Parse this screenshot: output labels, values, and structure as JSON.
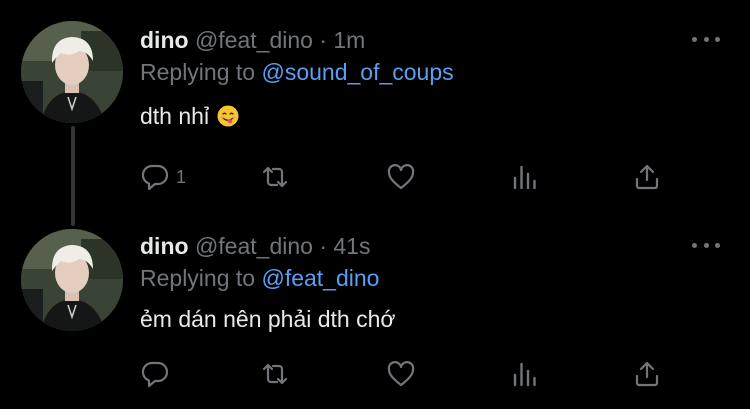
{
  "colors": {
    "background": "#000000",
    "text_primary": "#e7e9ea",
    "text_secondary": "#71767b",
    "link": "#5b9ef5",
    "thread_line": "#333639"
  },
  "tweets": [
    {
      "display_name": "dino",
      "handle": "@feat_dino",
      "separator": "·",
      "time": "1m",
      "replying_prefix": "Replying to",
      "replying_to": "@sound_of_coups",
      "text": "dth nhỉ",
      "emoji": "smiling-face-tongue-icon",
      "actions": {
        "reply_icon": "reply-icon",
        "reply_count": "1",
        "retweet_icon": "retweet-icon",
        "like_icon": "heart-icon",
        "analytics_icon": "analytics-icon",
        "share_icon": "share-icon"
      }
    },
    {
      "display_name": "dino",
      "handle": "@feat_dino",
      "separator": "·",
      "time": "41s",
      "replying_prefix": "Replying to",
      "replying_to": "@feat_dino",
      "text": "ẻm dán nên phải dth chớ",
      "actions": {
        "reply_icon": "reply-icon",
        "reply_count": "",
        "retweet_icon": "retweet-icon",
        "like_icon": "heart-icon",
        "analytics_icon": "analytics-icon",
        "share_icon": "share-icon"
      }
    }
  ]
}
